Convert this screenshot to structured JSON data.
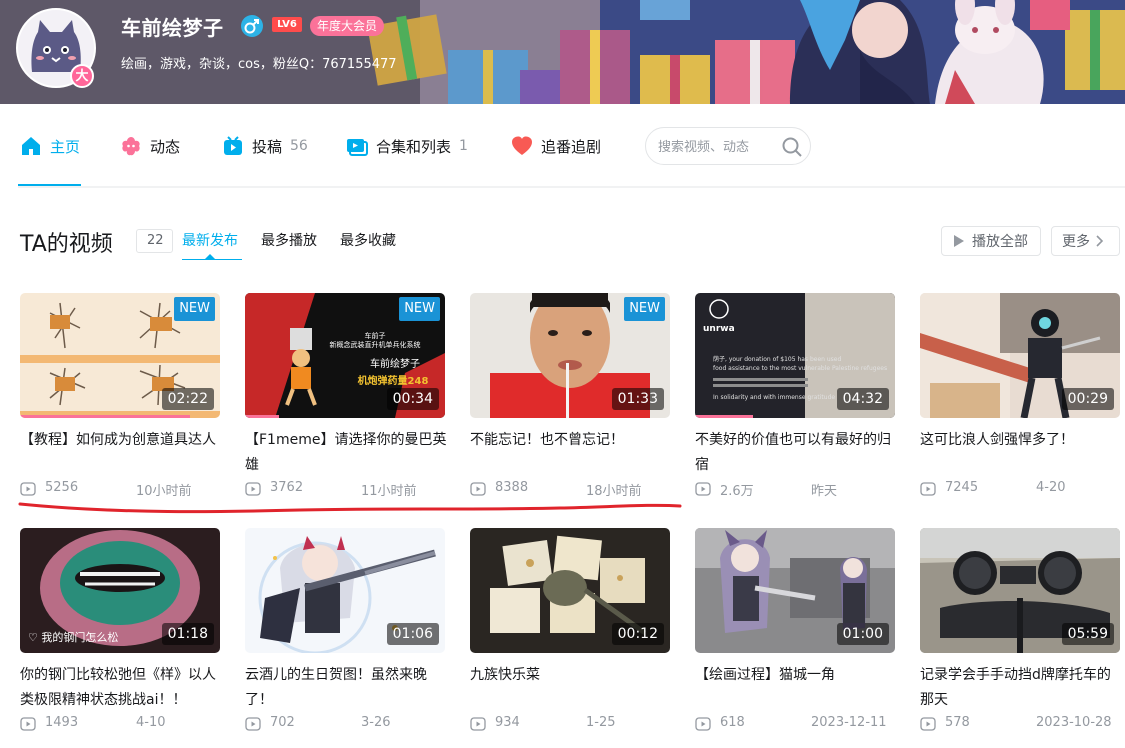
{
  "user": {
    "name": "车前绘梦子",
    "level": "LV6",
    "vip_badge": "年度大会员",
    "avatar_badge": "大",
    "signature": "绘画，游戏，杂谈，cos，粉丝Q：767155477"
  },
  "nav": {
    "items": [
      {
        "label": "主页",
        "count": "",
        "icon": "home-icon"
      },
      {
        "label": "动态",
        "count": "",
        "icon": "dynamic-icon"
      },
      {
        "label": "投稿",
        "count": "56",
        "icon": "upload-icon"
      },
      {
        "label": "合集和列表",
        "count": "1",
        "icon": "collection-icon"
      },
      {
        "label": "追番追剧",
        "count": "",
        "icon": "heart-icon"
      }
    ],
    "search_placeholder": "搜索视频、动态"
  },
  "section": {
    "title": "TA的视频",
    "count": "22",
    "tabs": [
      "最新发布",
      "最多播放",
      "最多收藏"
    ],
    "play_all_label": "播放全部",
    "more_label": "更多"
  },
  "videos": [
    {
      "title": "【教程】如何成为创意道具达人",
      "duration": "02:22",
      "views": "5256",
      "date": "10小时前",
      "is_new": "NEW"
    },
    {
      "title": "【F1meme】请选择你的曼巴英雄",
      "duration": "00:34",
      "views": "3762",
      "date": "11小时前",
      "is_new": "NEW"
    },
    {
      "title": "不能忘记！也不曾忘记！",
      "duration": "01:33",
      "views": "8388",
      "date": "18小时前",
      "is_new": "NEW"
    },
    {
      "title": "不美好的价值也可以有最好的归宿",
      "duration": "04:32",
      "views": "2.6万",
      "date": "昨天",
      "is_new": ""
    },
    {
      "title": "这可比浪人剑强悍多了！",
      "duration": "00:29",
      "views": "7245",
      "date": "4-20",
      "is_new": ""
    },
    {
      "title": "你的钢门比较松弛但《样》以人类极限精神状态挑战ai！！",
      "duration": "01:18",
      "views": "1493",
      "date": "4-10",
      "is_new": ""
    },
    {
      "title": "云酒儿的生日贺图！虽然来晚了！",
      "duration": "01:06",
      "views": "702",
      "date": "3-26",
      "is_new": ""
    },
    {
      "title": "九族快乐菜",
      "duration": "00:12",
      "views": "934",
      "date": "1-25",
      "is_new": ""
    },
    {
      "title": "【绘画过程】猫城一角",
      "duration": "01:00",
      "views": "618",
      "date": "2023-12-11",
      "is_new": ""
    },
    {
      "title": "记录学会手手动挡d牌摩托车的那天",
      "duration": "05:59",
      "views": "578",
      "date": "2023-10-28",
      "is_new": ""
    }
  ],
  "thumb_text": {
    "v2_line1": "车前子",
    "v2_line2": "新概念武装直升机单兵化系统",
    "v2_line3": "车前绘梦子",
    "v2_line4": "机炮弹药量248",
    "v4_line1": "unrwa",
    "v4_line2": "荫子, your donation of $105 has been used",
    "v4_line3": "food assistance to the most vulnerable Palestine refugees",
    "v4_line4": "In solidarity and with immense gratitude",
    "v6_caption": "♡ 我的钢门怎么松"
  },
  "colors": {
    "accent": "#00aeec",
    "pink": "#fb7299",
    "text": "#18191c",
    "muted": "#9499a0",
    "new_badge": "#1a93d6",
    "annotation_red": "#e0242c"
  }
}
